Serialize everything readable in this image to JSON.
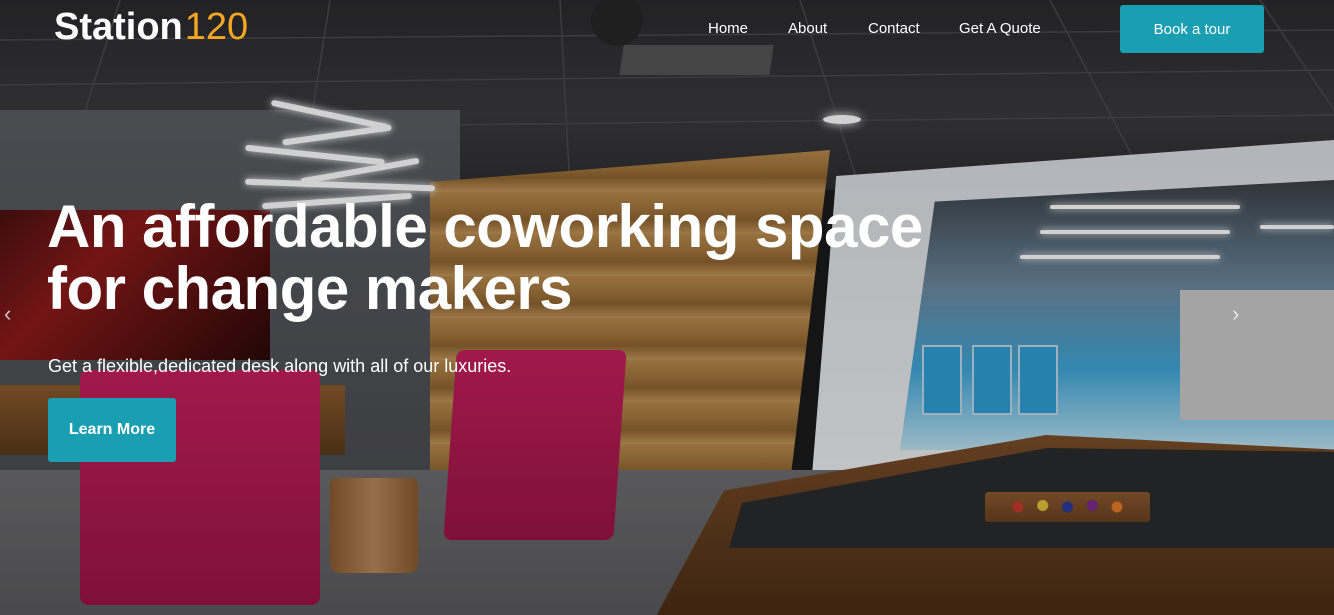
{
  "brand": {
    "name": "Station",
    "number": "120"
  },
  "nav": {
    "items": [
      {
        "label": "Home"
      },
      {
        "label": "About"
      },
      {
        "label": "Contact"
      },
      {
        "label": "Get A Quote"
      }
    ],
    "cta_label": "Book a tour"
  },
  "hero": {
    "headline_line1": "An affordable coworking space",
    "headline_line2": "for change makers",
    "subline": "Get a flexible,dedicated desk along with all of our luxuries.",
    "button_label": "Learn More",
    "prev_arrow": "‹",
    "next_arrow": "›"
  },
  "colors": {
    "accent": "#1a9fb2",
    "brand_number": "#f5a623",
    "text": "#ffffff"
  }
}
